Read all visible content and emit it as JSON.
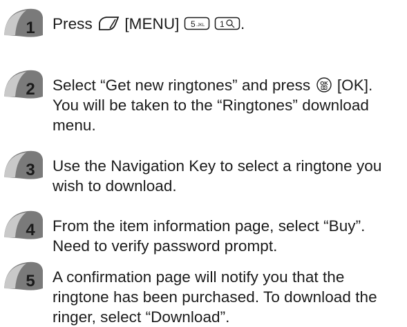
{
  "steps": [
    {
      "number": "1",
      "segments": [
        "Press ",
        " [MENU] ",
        " ",
        "."
      ],
      "keys": [
        "soft-key-icon",
        "5 JKL",
        "1"
      ]
    },
    {
      "number": "2",
      "segments": [
        "Select “Get new ringtones” and press ",
        " [OK]."
      ],
      "lines": [
        "You will be taken to the “Ringtones” download",
        "menu."
      ],
      "keys": [
        "OK"
      ]
    },
    {
      "number": "3",
      "lines": [
        "Use the Navigation Key to select a ringtone you",
        "wish to download."
      ]
    },
    {
      "number": "4",
      "lines": [
        "From the item information page, select “Buy”.",
        "Need to verify password prompt."
      ]
    },
    {
      "number": "5",
      "lines": [
        "A confirmation page will notify you that the",
        "ringtone has been purchased. To download the",
        "ringer, select “Download”."
      ]
    }
  ],
  "colors": {
    "badge_dark": "#6a6a6a",
    "badge_light": "#d6d6d6",
    "number": "#1a1a1a"
  }
}
